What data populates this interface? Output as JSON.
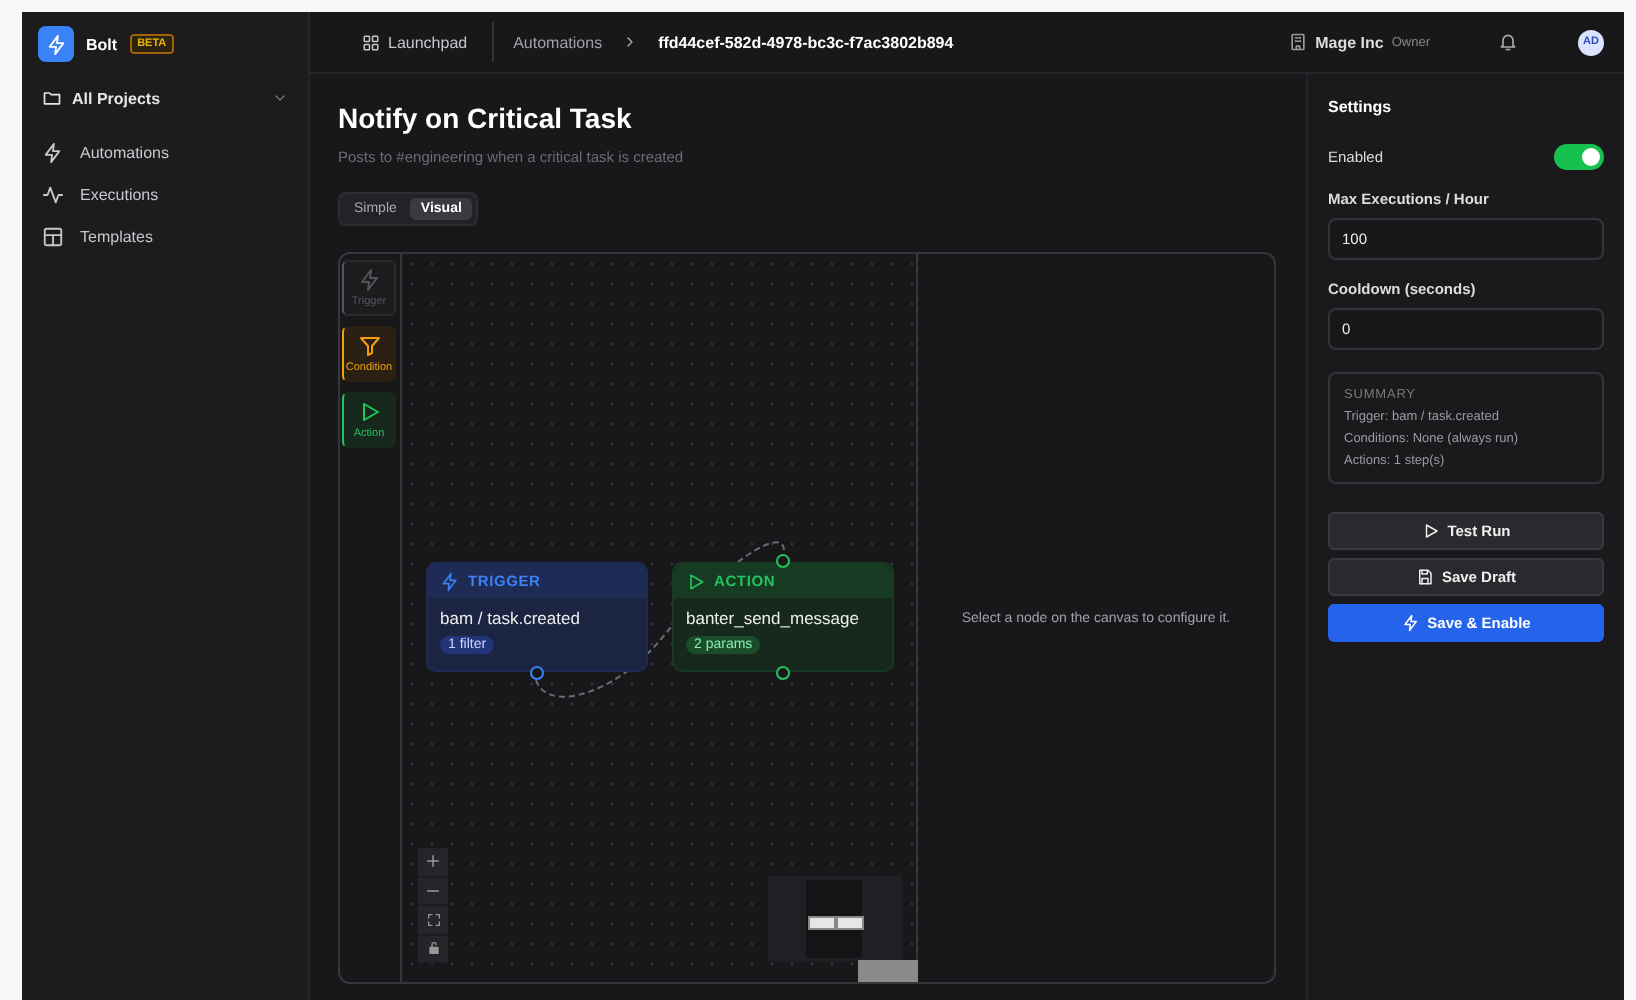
{
  "sidebar": {
    "brand": "Bolt",
    "badge": "BETA",
    "project": "All Projects",
    "items": [
      {
        "label": "Automations",
        "kind": "bolt",
        "selected": false
      },
      {
        "label": "Executions",
        "kind": "pulse",
        "selected": false
      },
      {
        "label": "Templates",
        "kind": "layout",
        "selected": false
      }
    ]
  },
  "header": {
    "launchpad": "Launchpad",
    "breadcrumb": [
      "Automations",
      "ffd44cef-582d-4978-bc3c-f7ac3802b894"
    ],
    "org": "Mage Inc",
    "role": "Owner",
    "avatar": "AD"
  },
  "page": {
    "title": "Notify on Critical Task",
    "description": "Posts to #engineering when a critical task is created",
    "modes": [
      {
        "label": "Simple",
        "selected": false
      },
      {
        "label": "Visual",
        "selected": true
      }
    ]
  },
  "palette": [
    {
      "label": "Trigger",
      "kind": "trigger",
      "disabled": true
    },
    {
      "label": "Condition",
      "kind": "condition",
      "disabled": false
    },
    {
      "label": "Action",
      "kind": "action",
      "disabled": false
    }
  ],
  "nodes": [
    {
      "kind": "trigger",
      "heading": "TRIGGER",
      "title": "bam / task.created",
      "badge": "1 filter"
    },
    {
      "kind": "action",
      "heading": "ACTION",
      "title": "banter_send_message",
      "badge": "2 params"
    }
  ],
  "config_hint": "Select a node on the canvas to configure it.",
  "settings": {
    "title": "Settings",
    "enabled_label": "Enabled",
    "enabled": true,
    "fields": [
      {
        "label": "Max Executions / Hour",
        "value": "100"
      },
      {
        "label": "Cooldown (seconds)",
        "value": "0"
      }
    ],
    "summary": {
      "title": "SUMMARY",
      "lines": [
        "Trigger: bam / task.created",
        "Conditions: None (always run)",
        "Actions: 1 step(s)"
      ]
    },
    "buttons": [
      {
        "label": "Test Run",
        "kind": "test"
      },
      {
        "label": "Save Draft",
        "kind": "draft"
      },
      {
        "label": "Save & Enable",
        "kind": "primary"
      }
    ]
  }
}
